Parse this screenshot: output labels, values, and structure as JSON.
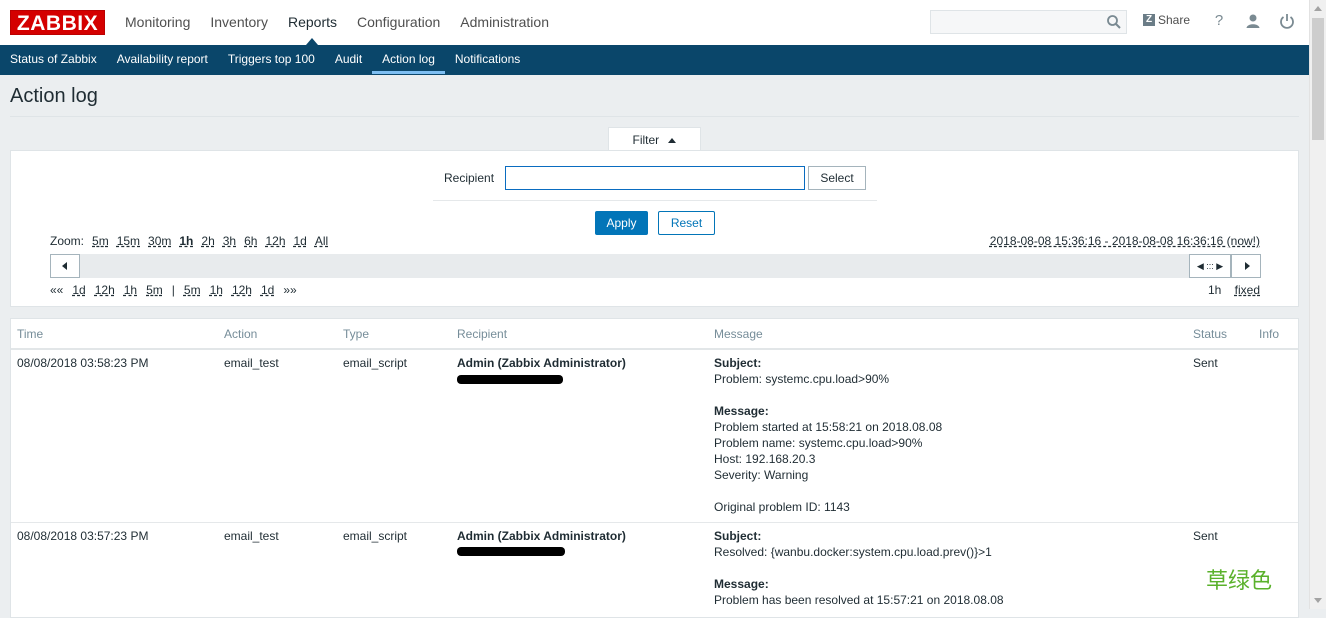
{
  "app": {
    "logo": "ZABBIX"
  },
  "mainnav": [
    "Monitoring",
    "Inventory",
    "Reports",
    "Configuration",
    "Administration"
  ],
  "mainnav_active": "Reports",
  "header": {
    "share_label": "Share",
    "help_glyph": "?",
    "icons": [
      "search-icon",
      "share-icon",
      "help-icon",
      "user-icon",
      "logout-icon"
    ]
  },
  "subnav": [
    "Status of Zabbix",
    "Availability report",
    "Triggers top 100",
    "Audit",
    "Action log",
    "Notifications"
  ],
  "subnav_active": "Action log",
  "page": {
    "title": "Action log"
  },
  "filter": {
    "tab_label": "Filter",
    "recipient_label": "Recipient",
    "recipient_value": "",
    "select_label": "Select",
    "apply_label": "Apply",
    "reset_label": "Reset"
  },
  "timeline": {
    "zoom_label": "Zoom:",
    "zoom_options": [
      "5m",
      "15m",
      "30m",
      "1h",
      "2h",
      "3h",
      "6h",
      "12h",
      "1d",
      "All"
    ],
    "zoom_active": "1h",
    "range": "2018-08-08 15:36:16 - 2018-08-08 16:36:16 (now!)",
    "back_start": "««",
    "back": [
      "1d",
      "12h",
      "1h",
      "5m"
    ],
    "sep": "|",
    "fwd": [
      "5m",
      "1h",
      "12h",
      "1d"
    ],
    "fwd_end": "»»",
    "period": "1h",
    "fixed": "fixed"
  },
  "table": {
    "columns": [
      "Time",
      "Action",
      "Type",
      "Recipient",
      "Message",
      "Status",
      "Info"
    ],
    "rows": [
      {
        "time": "08/08/2018 03:58:23 PM",
        "action": "email_test",
        "type": "email_script",
        "recipient": "Admin (Zabbix Administrator)",
        "subject_label": "Subject:",
        "subject": "Problem: systemc.cpu.load>90%",
        "message_label": "Message:",
        "message_lines": [
          "Problem started at 15:58:21 on 2018.08.08",
          "Problem name: systemc.cpu.load>90%",
          "Host: 192.168.20.3",
          "Severity: Warning",
          "",
          "Original problem ID: 1143"
        ],
        "status": "Sent"
      },
      {
        "time": "08/08/2018 03:57:23 PM",
        "action": "email_test",
        "type": "email_script",
        "recipient": "Admin (Zabbix Administrator)",
        "subject_label": "Subject:",
        "subject": "Resolved: {wanbu.docker:system.cpu.load.prev()}>1",
        "message_label": "Message:",
        "message_lines": [
          "Problem has been resolved at 15:57:21 on 2018.08.08"
        ],
        "status": "Sent"
      }
    ]
  },
  "watermark": "草绿色",
  "colors": {
    "brand": "#d40000",
    "subnav_bg": "#0a466a",
    "primary": "#0275b8",
    "sent": "#429e47"
  }
}
